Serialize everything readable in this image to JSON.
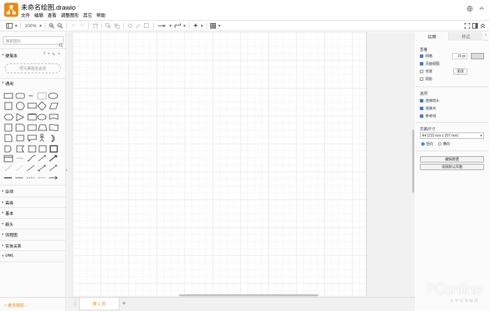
{
  "app": {
    "title": "未命名绘图.drawio",
    "brand_color": "#f08705",
    "menu": [
      "文件",
      "编辑",
      "查看",
      "调整图形",
      "其它",
      "帮助"
    ]
  },
  "toolbar": {
    "zoom": "100%",
    "icons": [
      "layout-icon",
      "zoom-in-icon",
      "zoom-out-icon",
      "undo-icon",
      "redo-icon",
      "delete-icon",
      "to-front-icon",
      "to-back-icon",
      "fill-color-icon",
      "line-color-icon",
      "shadow-icon",
      "connection-icon",
      "waypoint-icon",
      "insert-icon",
      "table-icon",
      "fullscreen-icon",
      "format-panel-icon",
      "collapse-icon"
    ]
  },
  "sidebar": {
    "search_placeholder": "搜索图形",
    "scratchpad": {
      "title": "便笺本",
      "help": "?",
      "drop_hint": "把元素拖至此处"
    },
    "sections": [
      "通用",
      "杂项",
      "高级",
      "基本",
      "箭头",
      "流程图",
      "实体关系",
      "UML"
    ],
    "more_shapes": "+ 更多图形..."
  },
  "pages": {
    "tab": "第 1 页"
  },
  "format_panel": {
    "tabs": [
      "绘图",
      "样式"
    ],
    "view": {
      "heading": "查看",
      "grid": "网格",
      "grid_size": "10 pt",
      "page_view": "页面视图",
      "background": "背景",
      "shadow": "阴影",
      "change_button": "更改"
    },
    "options": {
      "heading": "选项",
      "connection_arrows": "连接箭头",
      "connection_points": "连接点",
      "guides": "参考线"
    },
    "paper": {
      "heading": "页面尺寸",
      "size": "A4 (210 mm x 297 mm)",
      "portrait": "竖向",
      "landscape": "横向"
    },
    "buttons": {
      "edit_data": "编辑数据",
      "clear_default_style": "清除默认风格"
    }
  },
  "watermark": {
    "brand": "PConline",
    "sub": "太平洋电脑网"
  }
}
